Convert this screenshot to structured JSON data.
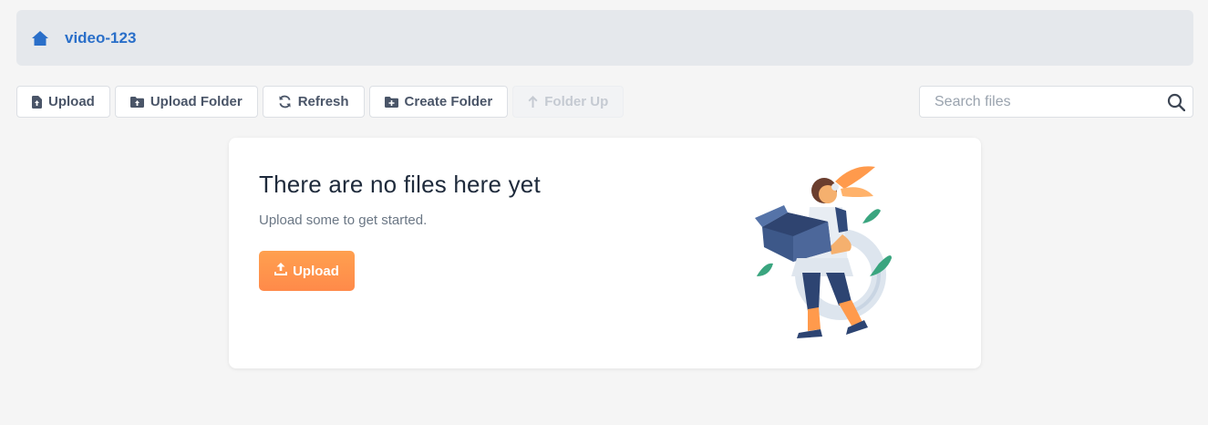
{
  "breadcrumb": {
    "current": "video-123"
  },
  "toolbar": {
    "upload": "Upload",
    "upload_folder": "Upload Folder",
    "refresh": "Refresh",
    "create_folder": "Create Folder",
    "folder_up": "Folder Up"
  },
  "search": {
    "placeholder": "Search files",
    "value": ""
  },
  "empty_state": {
    "title": "There are no files here yet",
    "subtitle": "Upload some to get started.",
    "upload_button": "Upload"
  },
  "icons": {
    "home": "home-icon",
    "file_upload": "file-upload-icon",
    "folder_upload": "folder-upload-icon",
    "refresh": "refresh-icon",
    "folder_plus": "folder-plus-icon",
    "arrow_up": "arrow-up-icon",
    "search": "search-icon",
    "upload": "upload-icon"
  },
  "colors": {
    "accent": "#2a6fc9",
    "upload_button": "#ff9a4c",
    "background": "#f5f5f5"
  }
}
